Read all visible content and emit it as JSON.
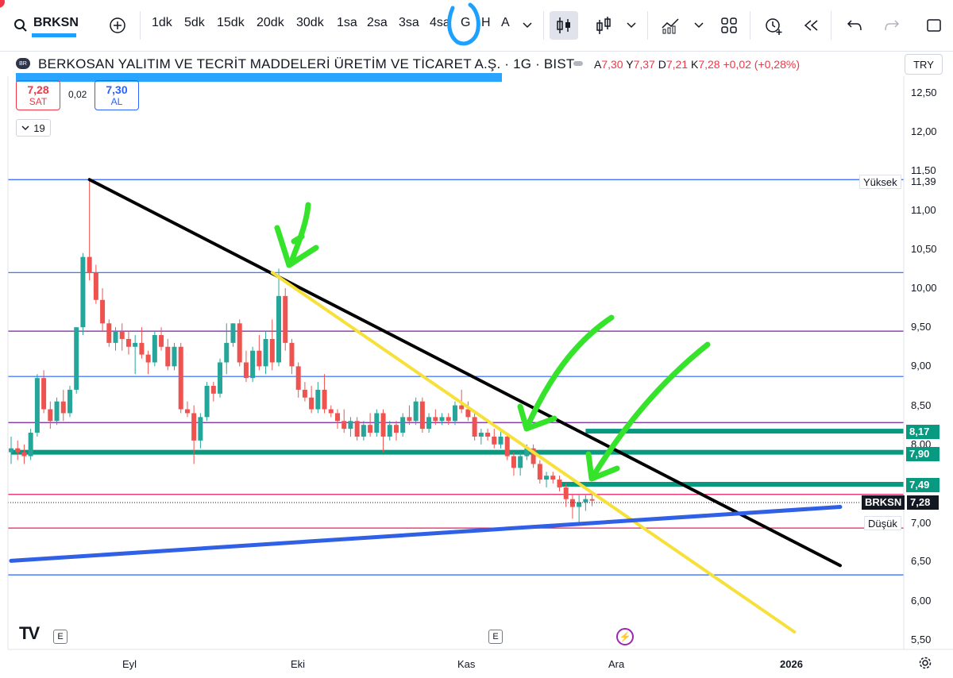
{
  "toolbar": {
    "symbol": "BRKSN",
    "intervals": [
      "1dk",
      "5dk",
      "15dk",
      "20dk",
      "30dk",
      "1sa",
      "2sa",
      "3sa",
      "4sa",
      "G",
      "H",
      "A"
    ]
  },
  "legend": {
    "title": "BERKOSAN YALITIM VE TECRİT MADDELERİ ÜRETİM VE TİCARET A.Ş. · 1G · BIST",
    "open_label": "A",
    "open": "7,30",
    "high_label": "Y",
    "high": "7,37",
    "low_label": "D",
    "low": "7,21",
    "close_label": "K",
    "close": "7,28",
    "change": "+0,02 (+0,28%)",
    "sell_price": "7,28",
    "sell_label": "SAT",
    "spread": "0,02",
    "buy_price": "7,30",
    "buy_label": "AL",
    "indicators_count": "19",
    "currency": "TRY"
  },
  "colors": {
    "up": "#26a69a",
    "down": "#ef5350",
    "hline_blue": "#2962ff",
    "hline_purple": "#7b1fa2",
    "hline_red": "#e91e63",
    "zone_green": "#089981",
    "trend_black": "#000000",
    "trend_yellow": "#f7e03a",
    "trend_blue": "#3060e6",
    "arrow_green": "#35e32a",
    "highlight_blue": "#1ea0ff"
  },
  "chart_data": {
    "type": "candlestick",
    "y_ticks": [
      "12,50",
      "12,00",
      "11,50",
      "11,00",
      "10,50",
      "10,00",
      "9,50",
      "9,00",
      "8,50",
      "8,00",
      "7,50",
      "7,00",
      "6,50",
      "6,00",
      "5,50"
    ],
    "ylim": [
      5.5,
      12.5
    ],
    "x_ticks": [
      "Eyl",
      "Eki",
      "Kas",
      "Ara",
      "2026"
    ],
    "labels": {
      "high": {
        "text": "Yüksek",
        "value": "11,39",
        "y": 11.39
      },
      "low": {
        "text": "Düşük",
        "value": "7,00",
        "y": 7.0
      },
      "last": {
        "text": "BRKSN",
        "value": "7,28",
        "y": 7.28
      },
      "levels": [
        {
          "value": "8,17",
          "y": 8.17
        },
        {
          "value": "7,90",
          "y": 7.9
        },
        {
          "value": "7,49",
          "y": 7.49
        }
      ]
    },
    "horizontal_lines": [
      {
        "y": 11.39,
        "color": "blue"
      },
      {
        "y": 10.2,
        "color": "blue"
      },
      {
        "y": 9.45,
        "color": "purple"
      },
      {
        "y": 8.87,
        "color": "blue"
      },
      {
        "y": 8.28,
        "color": "purple"
      },
      {
        "y": 7.36,
        "color": "red"
      },
      {
        "y": 6.93,
        "color": "red"
      },
      {
        "y": 6.33,
        "color": "blue"
      }
    ],
    "zones": [
      {
        "y": 8.17,
        "from_day": 88
      },
      {
        "y": 7.9,
        "from_day": 0
      },
      {
        "y": 7.49,
        "from_day": 84
      }
    ],
    "trendlines": [
      {
        "color": "black",
        "from": [
          12,
          11.39
        ],
        "to": [
          127,
          6.45
        ]
      },
      {
        "color": "yellow",
        "from": [
          40,
          10.2
        ],
        "to": [
          120,
          5.6
        ]
      },
      {
        "color": "blue",
        "from": [
          0,
          6.51
        ],
        "to": [
          127,
          7.2
        ]
      }
    ],
    "ohlc": [
      [
        7.9,
        8.1,
        7.75,
        7.95
      ],
      [
        7.95,
        8.05,
        7.8,
        7.9
      ],
      [
        7.9,
        8.0,
        7.75,
        7.85
      ],
      [
        7.85,
        8.2,
        7.8,
        8.15
      ],
      [
        8.15,
        8.9,
        8.1,
        8.85
      ],
      [
        8.85,
        8.95,
        8.4,
        8.45
      ],
      [
        8.45,
        8.55,
        8.2,
        8.3
      ],
      [
        8.3,
        8.6,
        8.25,
        8.55
      ],
      [
        8.55,
        8.7,
        8.3,
        8.4
      ],
      [
        8.4,
        8.75,
        8.35,
        8.7
      ],
      [
        8.7,
        9.5,
        8.65,
        9.5
      ],
      [
        9.5,
        10.45,
        9.4,
        10.4
      ],
      [
        10.4,
        11.39,
        10.1,
        10.2
      ],
      [
        10.2,
        10.3,
        9.8,
        9.85
      ],
      [
        9.85,
        10.0,
        9.45,
        9.55
      ],
      [
        9.55,
        9.6,
        9.25,
        9.3
      ],
      [
        9.3,
        9.5,
        9.2,
        9.45
      ],
      [
        9.45,
        9.55,
        9.2,
        9.35
      ],
      [
        9.35,
        9.45,
        9.15,
        9.25
      ],
      [
        9.25,
        9.4,
        8.9,
        9.3
      ],
      [
        9.3,
        9.5,
        9.1,
        9.15
      ],
      [
        9.15,
        9.2,
        8.9,
        9.05
      ],
      [
        9.05,
        9.45,
        9.0,
        9.4
      ],
      [
        9.4,
        9.5,
        9.2,
        9.25
      ],
      [
        9.25,
        9.35,
        8.95,
        9.0
      ],
      [
        9.0,
        9.3,
        8.95,
        9.25
      ],
      [
        9.25,
        9.3,
        8.4,
        8.45
      ],
      [
        8.45,
        8.55,
        8.35,
        8.4
      ],
      [
        8.4,
        8.5,
        7.75,
        8.05
      ],
      [
        8.05,
        8.4,
        7.95,
        8.35
      ],
      [
        8.35,
        8.8,
        8.3,
        8.75
      ],
      [
        8.75,
        8.8,
        8.55,
        8.65
      ],
      [
        8.65,
        9.1,
        8.6,
        9.05
      ],
      [
        9.05,
        9.55,
        8.9,
        9.3
      ],
      [
        9.3,
        9.55,
        9.25,
        9.55
      ],
      [
        9.55,
        9.6,
        9.0,
        9.05
      ],
      [
        9.05,
        9.2,
        8.8,
        8.85
      ],
      [
        8.85,
        9.25,
        8.8,
        9.2
      ],
      [
        9.2,
        9.4,
        8.95,
        9.0
      ],
      [
        9.0,
        9.45,
        8.9,
        9.35
      ],
      [
        9.35,
        9.6,
        8.95,
        9.05
      ],
      [
        9.05,
        10.25,
        9.0,
        9.9
      ],
      [
        9.9,
        10.0,
        9.2,
        9.3
      ],
      [
        9.3,
        9.35,
        8.9,
        9.0
      ],
      [
        9.0,
        9.05,
        8.6,
        8.7
      ],
      [
        8.7,
        8.8,
        8.55,
        8.6
      ],
      [
        8.6,
        8.75,
        8.4,
        8.45
      ],
      [
        8.45,
        8.8,
        8.4,
        8.7
      ],
      [
        8.7,
        8.9,
        8.4,
        8.45
      ],
      [
        8.45,
        8.5,
        8.35,
        8.4
      ],
      [
        8.4,
        8.45,
        8.2,
        8.3
      ],
      [
        8.3,
        8.45,
        8.15,
        8.2
      ],
      [
        8.2,
        8.35,
        8.1,
        8.3
      ],
      [
        8.3,
        8.35,
        8.05,
        8.1
      ],
      [
        8.1,
        8.3,
        8.05,
        8.25
      ],
      [
        8.25,
        8.4,
        8.1,
        8.15
      ],
      [
        8.15,
        8.45,
        8.1,
        8.4
      ],
      [
        8.4,
        8.45,
        7.9,
        8.1
      ],
      [
        8.1,
        8.3,
        8.05,
        8.25
      ],
      [
        8.25,
        8.3,
        8.05,
        8.15
      ],
      [
        8.15,
        8.4,
        8.1,
        8.35
      ],
      [
        8.35,
        8.5,
        8.25,
        8.3
      ],
      [
        8.3,
        8.6,
        8.25,
        8.55
      ],
      [
        8.55,
        8.6,
        8.15,
        8.2
      ],
      [
        8.2,
        8.4,
        8.15,
        8.35
      ],
      [
        8.35,
        8.45,
        8.25,
        8.3
      ],
      [
        8.3,
        8.4,
        8.25,
        8.35
      ],
      [
        8.35,
        8.4,
        8.25,
        8.3
      ],
      [
        8.3,
        8.55,
        8.25,
        8.5
      ],
      [
        8.5,
        8.7,
        8.4,
        8.45
      ],
      [
        8.45,
        8.55,
        8.3,
        8.35
      ],
      [
        8.35,
        8.4,
        8.05,
        8.1
      ],
      [
        8.1,
        8.2,
        8.0,
        8.15
      ],
      [
        8.15,
        8.2,
        8.05,
        8.1
      ],
      [
        8.1,
        8.2,
        7.95,
        8.0
      ],
      [
        8.0,
        8.2,
        7.95,
        8.1
      ],
      [
        8.1,
        8.15,
        7.8,
        7.85
      ],
      [
        7.85,
        7.9,
        7.6,
        7.7
      ],
      [
        7.7,
        7.9,
        7.6,
        7.85
      ],
      [
        7.85,
        8.0,
        7.8,
        7.95
      ],
      [
        7.95,
        8.0,
        7.7,
        7.75
      ],
      [
        7.75,
        7.8,
        7.5,
        7.55
      ],
      [
        7.55,
        7.65,
        7.45,
        7.6
      ],
      [
        7.6,
        7.65,
        7.5,
        7.55
      ],
      [
        7.55,
        7.6,
        7.4,
        7.45
      ],
      [
        7.45,
        7.5,
        7.2,
        7.3
      ],
      [
        7.3,
        7.35,
        7.05,
        7.2
      ],
      [
        7.2,
        7.35,
        7.0,
        7.26
      ],
      [
        7.26,
        7.35,
        7.15,
        7.3
      ],
      [
        7.3,
        7.37,
        7.21,
        7.28
      ]
    ]
  }
}
